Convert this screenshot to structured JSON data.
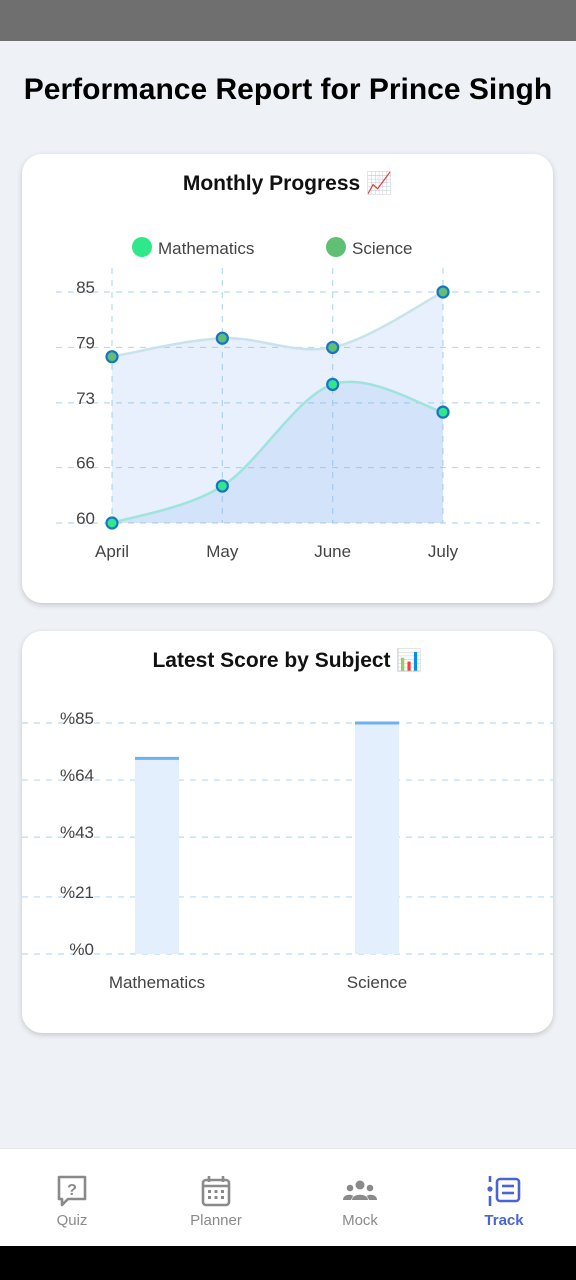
{
  "page": {
    "title": "Performance Report for Prince Singh"
  },
  "line_card": {
    "title": "Monthly Progress 📈"
  },
  "bar_card": {
    "title": "Latest Score by Subject 📊"
  },
  "chart_data": [
    {
      "type": "area",
      "title": "Monthly Progress 📈",
      "categories": [
        "April",
        "May",
        "June",
        "July"
      ],
      "y_ticks": [
        "60",
        "66",
        "73",
        "79",
        "85"
      ],
      "ylim": [
        60,
        85
      ],
      "grid": true,
      "legend_position": "top",
      "series": [
        {
          "name": "Mathematics",
          "values": [
            60,
            64,
            75,
            72
          ],
          "color": "#2ee88a"
        },
        {
          "name": "Science",
          "values": [
            78,
            80,
            79,
            85
          ],
          "color": "#5fbf74"
        }
      ]
    },
    {
      "type": "bar",
      "title": "Latest Score by Subject 📊",
      "categories": [
        "Mathematics",
        "Science"
      ],
      "values": [
        72,
        85
      ],
      "y_ticks": [
        "%0",
        "%21",
        "%43",
        "%64",
        "%85"
      ],
      "ylim": [
        0,
        85
      ],
      "grid": true
    }
  ],
  "nav": {
    "items": [
      {
        "label": "Quiz",
        "icon": "quiz-icon"
      },
      {
        "label": "Planner",
        "icon": "calendar-icon"
      },
      {
        "label": "Mock",
        "icon": "group-icon"
      },
      {
        "label": "Track",
        "icon": "track-list-icon"
      }
    ],
    "active": 3,
    "active_color": "#4a63d8",
    "inactive_color": "#8a8a8a"
  }
}
